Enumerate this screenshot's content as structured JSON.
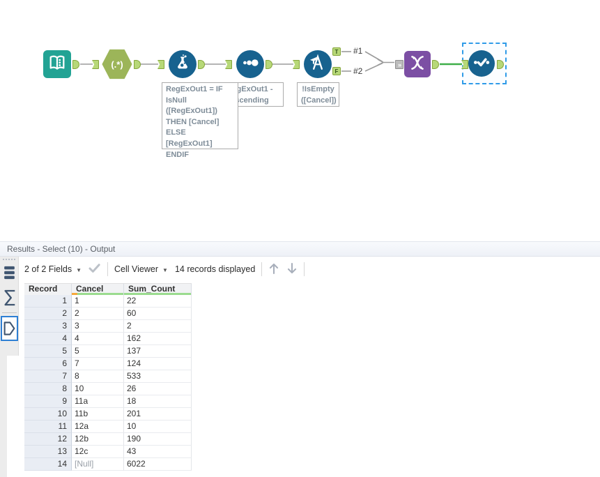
{
  "canvas": {
    "regex_glyph": "(.*)",
    "annotations": {
      "formula": "RegExOut1 = IF\nIsNull\n([RegExOut1])\nTHEN [Cancel]\nELSE [RegExOut1]\nENDIF",
      "sort": "RegExOut1 -\nascending",
      "filter": "!IsEmpty\n([Cancel])"
    },
    "labels": {
      "true_branch": "#1",
      "false_branch": "#2",
      "anchor_true": "T",
      "anchor_false": "F",
      "union_in": "»"
    },
    "colors": {
      "tool_blue": "#17628f",
      "tool_teal": "#22a394",
      "tool_green": "#9cb559",
      "tool_purple": "#7c4fa4",
      "anchor_green": "#b7d878",
      "wire_gray": "#9b9b9b",
      "wire_green": "#3fae49",
      "selection_blue": "#2f9be8"
    }
  },
  "results": {
    "title": "Results - Select (10) - Output",
    "toolbar": {
      "fields_dropdown": "2 of 2 Fields",
      "cell_viewer_dropdown": "Cell Viewer",
      "records_displayed": "14 records displayed"
    },
    "table": {
      "columns": [
        "Record",
        "Cancel",
        "Sum_Count"
      ],
      "rows": [
        [
          "1",
          "1",
          "22"
        ],
        [
          "2",
          "2",
          "60"
        ],
        [
          "3",
          "3",
          "2"
        ],
        [
          "4",
          "4",
          "162"
        ],
        [
          "5",
          "5",
          "137"
        ],
        [
          "6",
          "7",
          "124"
        ],
        [
          "7",
          "8",
          "533"
        ],
        [
          "8",
          "10",
          "26"
        ],
        [
          "9",
          "11a",
          "18"
        ],
        [
          "10",
          "11b",
          "201"
        ],
        [
          "11",
          "12a",
          "10"
        ],
        [
          "12",
          "12b",
          "190"
        ],
        [
          "13",
          "12c",
          "43"
        ],
        [
          "14",
          "[Null]",
          "6022"
        ]
      ]
    }
  }
}
